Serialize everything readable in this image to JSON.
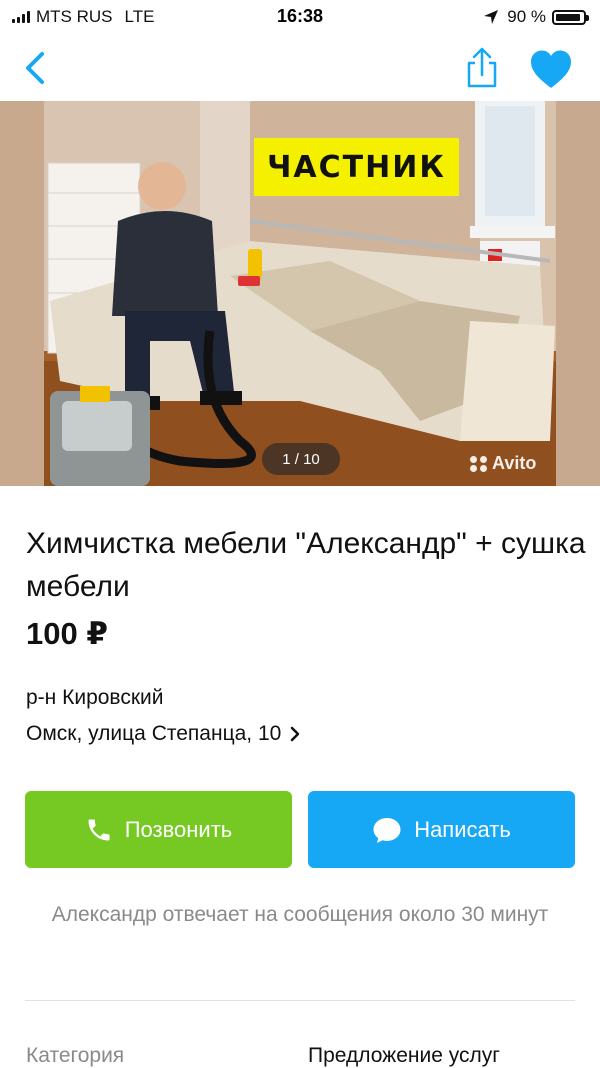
{
  "status_bar": {
    "carrier": "MTS RUS",
    "network": "LTE",
    "time": "16:38",
    "battery": "90 %"
  },
  "photo": {
    "badge": "ЧАСТНИК",
    "counter": "1 / 10",
    "watermark": "Avito"
  },
  "listing": {
    "title": "Химчистка мебели \"Александр\" + сушка мебели",
    "price": "100 ₽",
    "district": "р-н Кировский",
    "address": "Омск, улица Степанца, 10"
  },
  "actions": {
    "call_label": "Позвонить",
    "write_label": "Написать"
  },
  "reply_note": "Александр отвечает на сообщения около 30 минут",
  "details": {
    "category_label": "Категория",
    "category_value": "Предложение услуг"
  },
  "colors": {
    "accent_blue": "#17a8f5",
    "call_green": "#76c922",
    "badge_yellow": "#f4f000"
  },
  "icons": [
    "signal-icon",
    "location-arrow-icon",
    "battery-icon",
    "back-chevron-icon",
    "share-icon",
    "heart-icon",
    "phone-icon",
    "chat-bubble-icon",
    "chevron-right-icon"
  ]
}
